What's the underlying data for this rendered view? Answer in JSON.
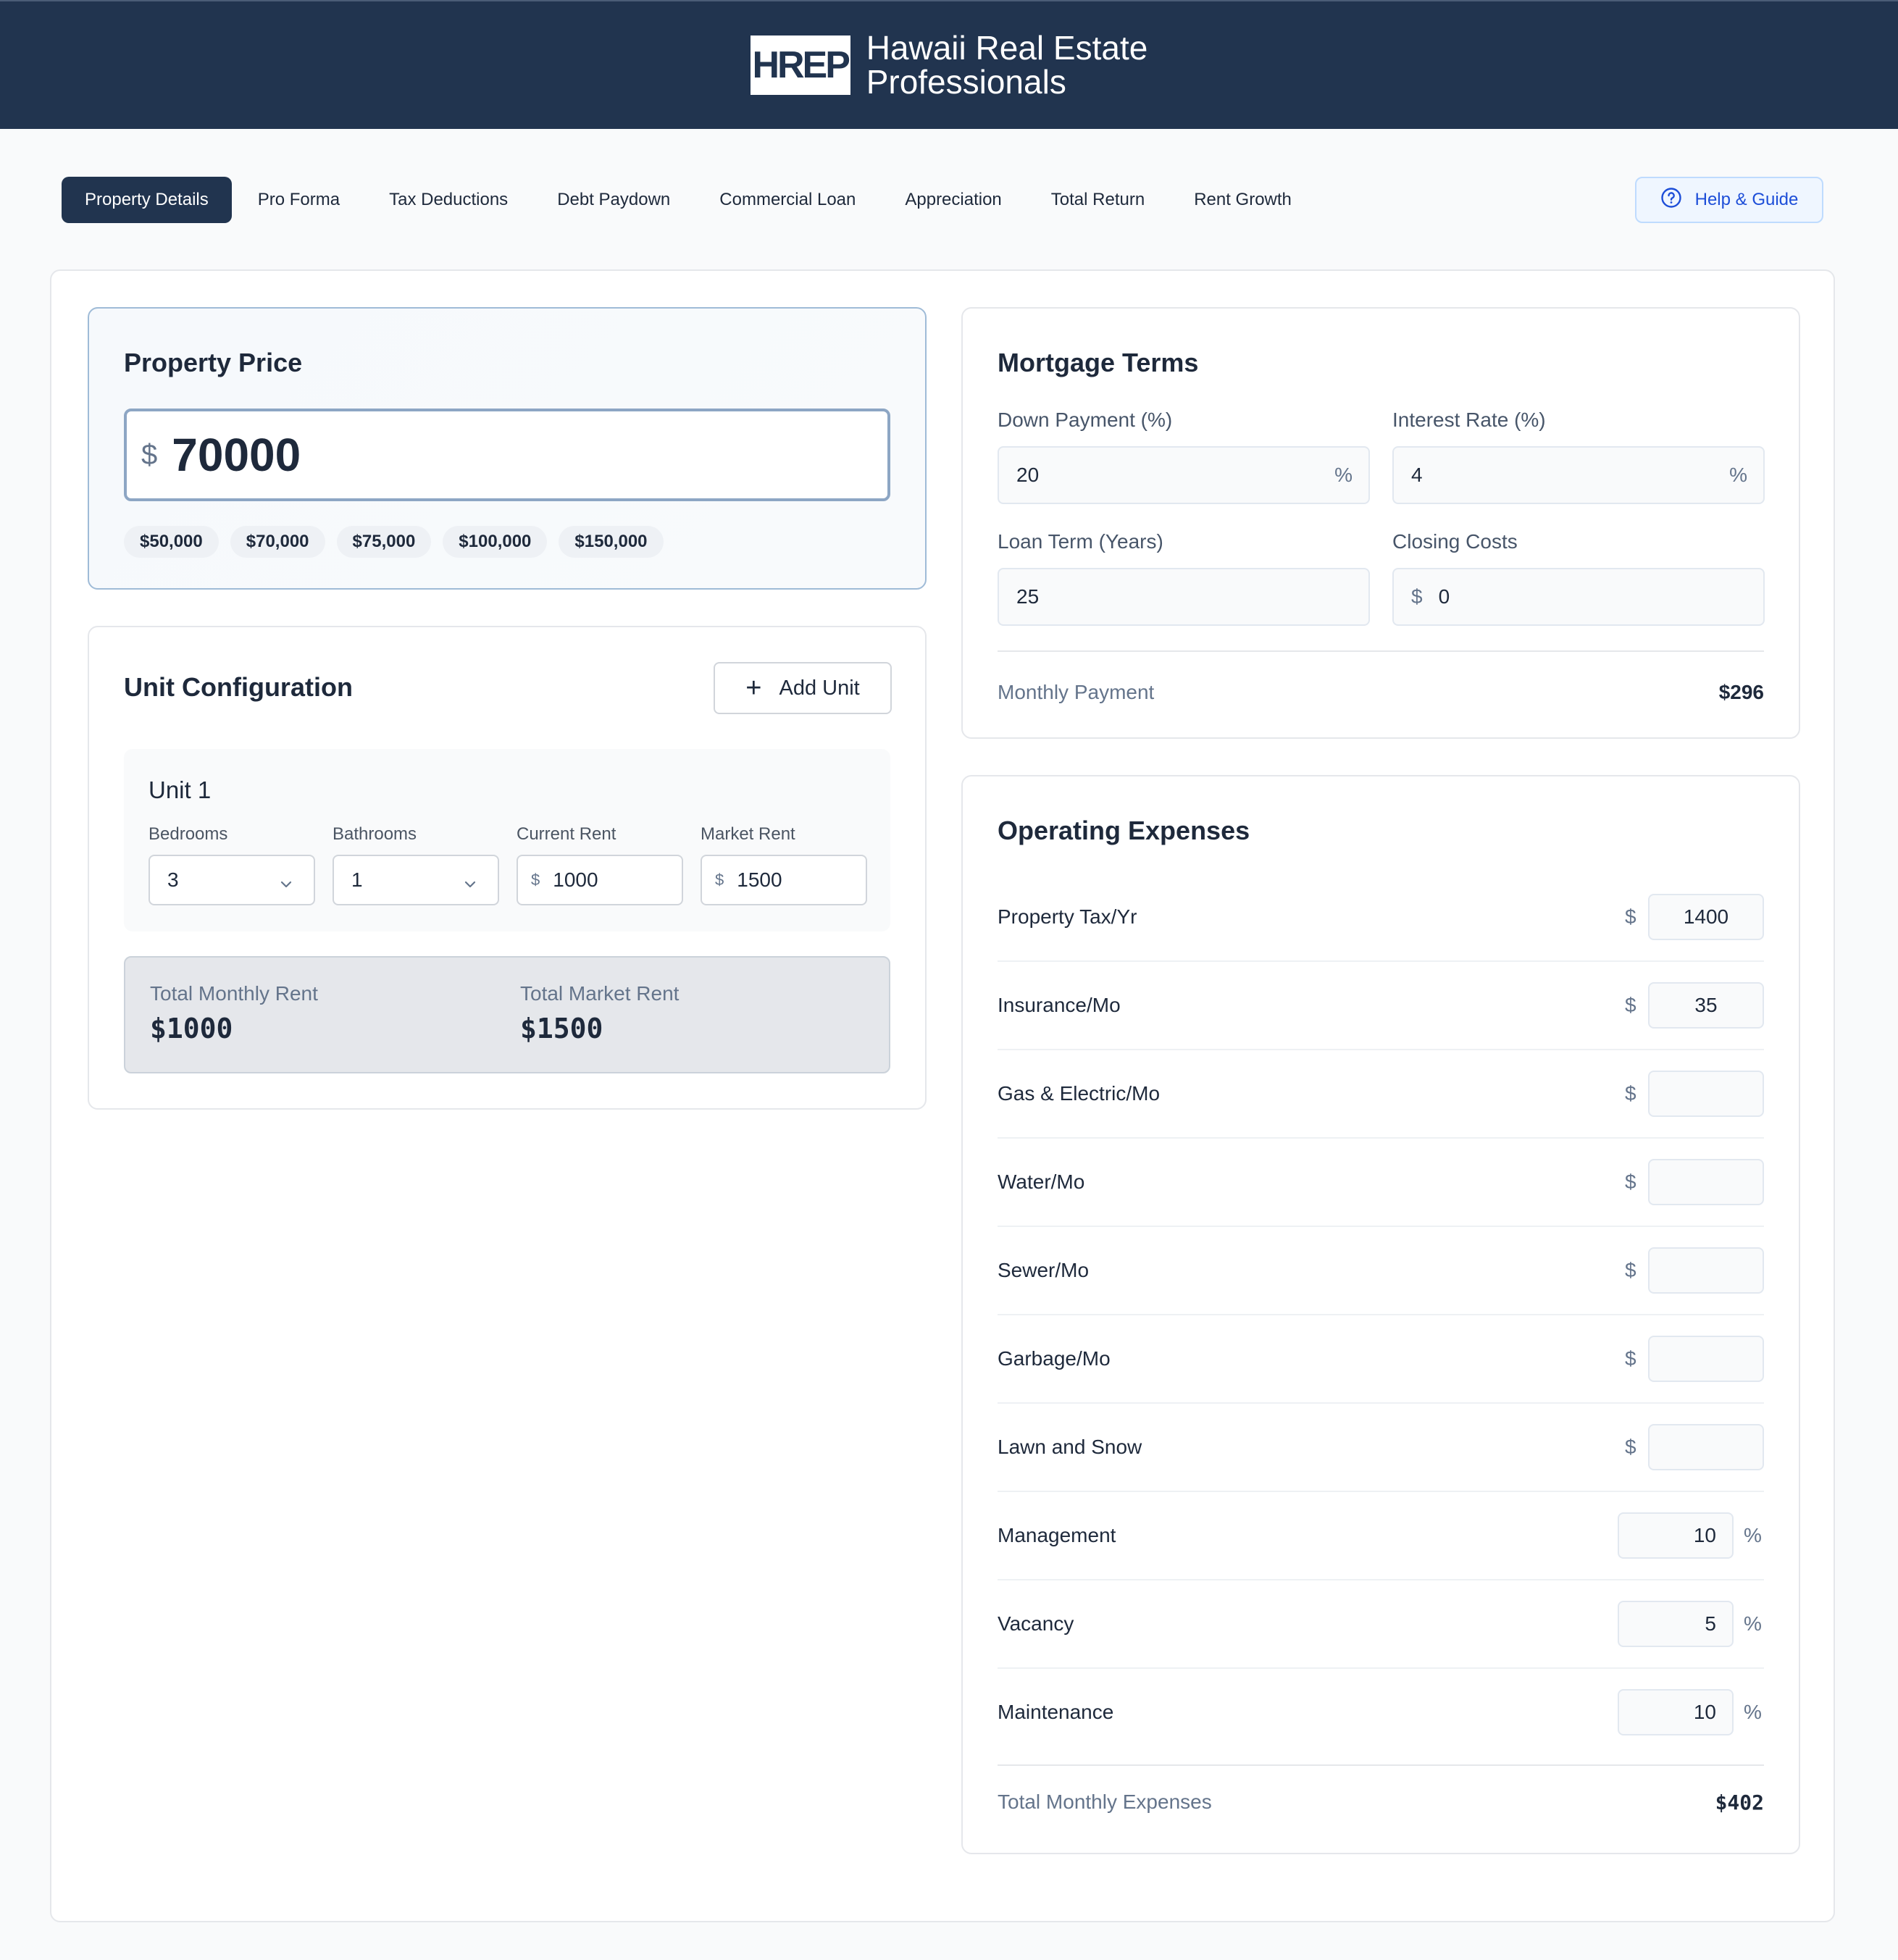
{
  "header": {
    "logo_text": "HREP",
    "brand_line1": "Hawaii Real Estate",
    "brand_line2": "Professionals"
  },
  "tabs": [
    {
      "label": "Property Details",
      "active": true
    },
    {
      "label": "Pro Forma"
    },
    {
      "label": "Tax Deductions"
    },
    {
      "label": "Debt Paydown"
    },
    {
      "label": "Commercial Loan"
    },
    {
      "label": "Appreciation"
    },
    {
      "label": "Total Return"
    },
    {
      "label": "Rent Growth"
    }
  ],
  "help": {
    "label": "Help & Guide",
    "icon": "question-circle-icon"
  },
  "property_price": {
    "title": "Property Price",
    "currency": "$",
    "value": "70000",
    "presets": [
      "$50,000",
      "$70,000",
      "$75,000",
      "$100,000",
      "$150,000"
    ]
  },
  "units": {
    "title": "Unit Configuration",
    "add_label": "Add Unit",
    "items": [
      {
        "name": "Unit 1",
        "bedrooms_label": "Bedrooms",
        "bedrooms": "3",
        "bathrooms_label": "Bathrooms",
        "bathrooms": "1",
        "current_rent_label": "Current Rent",
        "current_rent": "1000",
        "market_rent_label": "Market Rent",
        "market_rent": "1500",
        "currency": "$"
      }
    ],
    "total_monthly_rent_label": "Total Monthly Rent",
    "total_monthly_rent": "$1000",
    "total_market_rent_label": "Total Market Rent",
    "total_market_rent": "$1500"
  },
  "mortgage": {
    "title": "Mortgage Terms",
    "down_payment_label": "Down Payment (%)",
    "down_payment": "20",
    "interest_rate_label": "Interest Rate (%)",
    "interest_rate": "4",
    "loan_term_label": "Loan Term (Years)",
    "loan_term": "25",
    "closing_costs_label": "Closing Costs",
    "closing_costs": "0",
    "percent_symbol": "%",
    "currency": "$",
    "monthly_payment_label": "Monthly Payment",
    "monthly_payment": "$296"
  },
  "opex": {
    "title": "Operating Expenses",
    "currency": "$",
    "percent_symbol": "%",
    "rows": [
      {
        "label": "Property Tax/Yr",
        "value": "1400",
        "unit": "dollar"
      },
      {
        "label": "Insurance/Mo",
        "value": "35",
        "unit": "dollar"
      },
      {
        "label": "Gas & Electric/Mo",
        "value": "",
        "unit": "dollar"
      },
      {
        "label": "Water/Mo",
        "value": "",
        "unit": "dollar"
      },
      {
        "label": "Sewer/Mo",
        "value": "",
        "unit": "dollar"
      },
      {
        "label": "Garbage/Mo",
        "value": "",
        "unit": "dollar"
      },
      {
        "label": "Lawn and Snow",
        "value": "",
        "unit": "dollar"
      },
      {
        "label": "Management",
        "value": "10",
        "unit": "percent"
      },
      {
        "label": "Vacancy",
        "value": "5",
        "unit": "percent"
      },
      {
        "label": "Maintenance",
        "value": "10",
        "unit": "percent"
      }
    ],
    "total_label": "Total Monthly Expenses",
    "total": "$402"
  },
  "colors": {
    "header_bg": "#21344f",
    "accent_blue": "#1d4ed8",
    "page_bg": "#f9fafb"
  }
}
